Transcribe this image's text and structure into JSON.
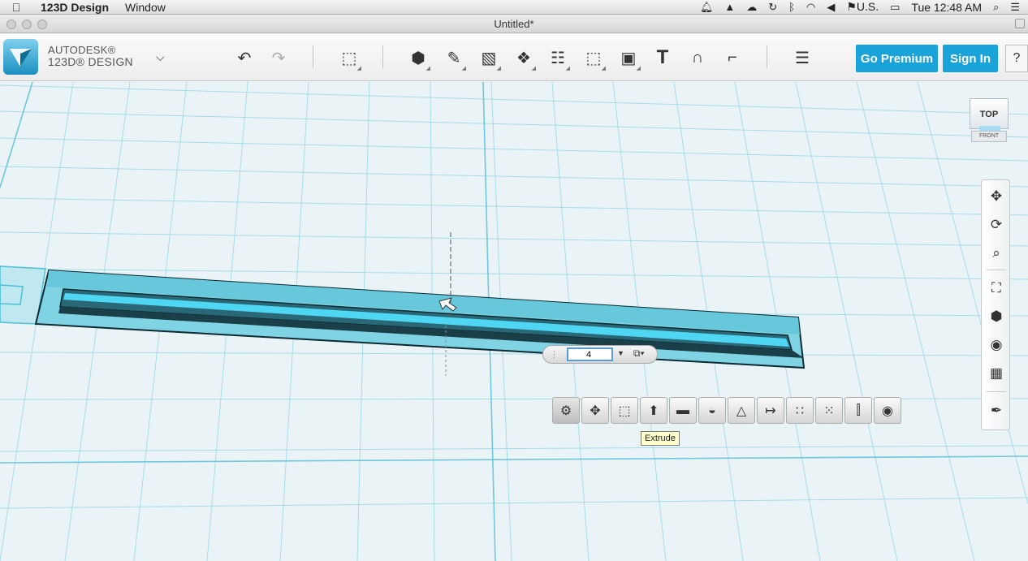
{
  "menubar": {
    "app_name": "123D Design",
    "menu_window": "Window",
    "input_source": "U.S.",
    "clock": "Tue 12:48 AM"
  },
  "window": {
    "title": "Untitled*"
  },
  "brand": {
    "line1": "AUTODESK®",
    "line2": "123D® DESIGN"
  },
  "toolbar": {
    "go_premium": "Go Premium",
    "sign_in": "Sign In",
    "help": "?",
    "text_tool_glyph": "T"
  },
  "viewcube": {
    "top_label": "TOP",
    "front_label": "FRONT"
  },
  "extrude": {
    "value": "4"
  },
  "context_tooltip": "Extrude",
  "colors": {
    "accent": "#1aa3d9",
    "grid_line": "#9fd8e8",
    "shape_fill": "#4fc2d8",
    "shape_edge": "#0b2a33"
  }
}
